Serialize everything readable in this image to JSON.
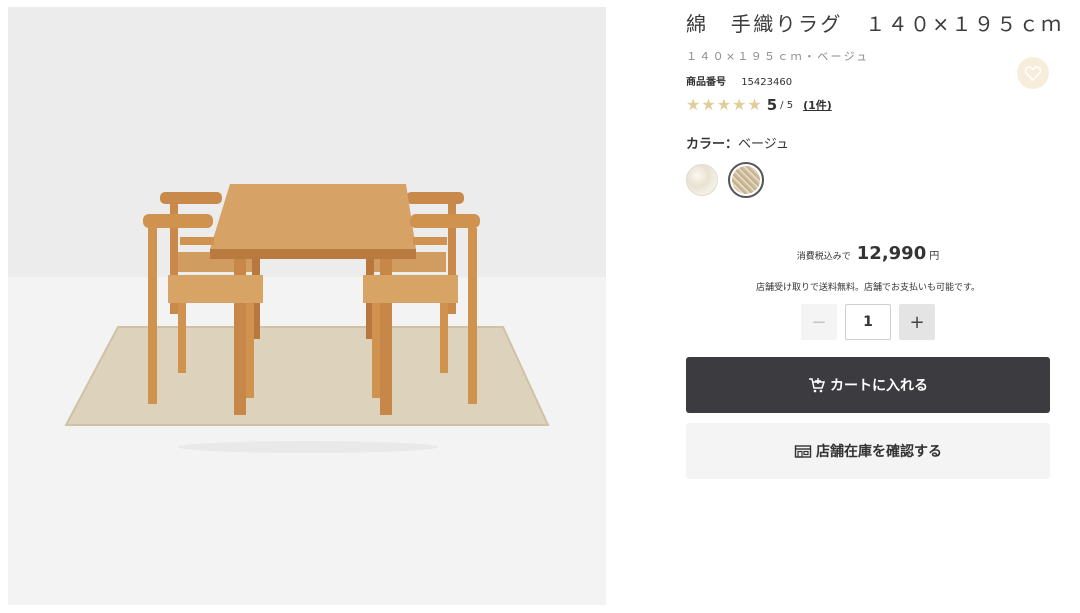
{
  "product": {
    "title": "綿　手織りラグ　１４０×１９５ｃｍ",
    "variant": "１４０×１９５ｃｍ・ベージュ",
    "sku_label": "商品番号",
    "sku": "15423460",
    "rating": {
      "score": "5",
      "out_of": "/ 5",
      "count": "(1件)",
      "stars": 5
    },
    "color_label": "カラー：",
    "color_value": "ベージュ",
    "swatches": [
      "オフ白",
      "ベージュ"
    ],
    "selected_swatch_index": 1,
    "image_alt": "ダイニングテーブルと椅子の下に敷かれたベージュの手織りラグ"
  },
  "purchase": {
    "tax_label": "消費税込みで",
    "price": "12,990",
    "currency": "円",
    "shipping_note": "店舗受け取りで送料無料。店舗でお支払いも可能です。",
    "quantity": "1",
    "minus_label": "−",
    "plus_label": "+",
    "cart_label": "カートに入れる",
    "store_label": "店舗在庫を確認する"
  },
  "colors": {
    "dark_button": "#3b3b40",
    "light_button": "#f4f4f4",
    "star": "#e0ce98",
    "favorite_bg": "#f7eddb"
  },
  "icons": [
    "heart-icon",
    "star-icon",
    "cart-icon",
    "store-icon"
  ]
}
